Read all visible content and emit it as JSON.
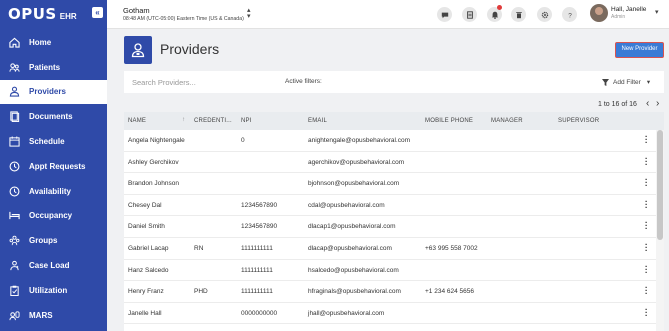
{
  "app": {
    "logo_main": "OPUS",
    "logo_sub": "EHR"
  },
  "location": {
    "name": "Gotham",
    "time": "08:48 AM (UTC-05:00) Eastern Time (US & Canada)"
  },
  "user": {
    "name": "Hall, Janelle",
    "role": "Admin"
  },
  "sidebar": {
    "items": [
      {
        "label": "Home",
        "icon": "home-icon"
      },
      {
        "label": "Patients",
        "icon": "patients-icon"
      },
      {
        "label": "Providers",
        "icon": "providers-icon",
        "active": true
      },
      {
        "label": "Documents",
        "icon": "documents-icon"
      },
      {
        "label": "Schedule",
        "icon": "calendar-icon"
      },
      {
        "label": "Appt Requests",
        "icon": "clock-icon"
      },
      {
        "label": "Availability",
        "icon": "clock-icon"
      },
      {
        "label": "Occupancy",
        "icon": "bed-icon"
      },
      {
        "label": "Groups",
        "icon": "groups-icon"
      },
      {
        "label": "Case Load",
        "icon": "caseload-icon"
      },
      {
        "label": "Utilization",
        "icon": "clipboard-icon"
      },
      {
        "label": "MARS",
        "icon": "mars-icon"
      }
    ]
  },
  "page": {
    "title": "Providers",
    "new_button": "New Provider"
  },
  "search": {
    "placeholder": "Search Providers..."
  },
  "filters": {
    "active_label": "Active filters:",
    "add_label": "Add Filter"
  },
  "pagination": {
    "text": "1 to 16 of 16"
  },
  "table": {
    "columns": [
      "NAME",
      "CREDENTI...",
      "NPI",
      "EMAIL",
      "MOBILE PHONE",
      "MANAGER",
      "SUPERVISOR"
    ],
    "rows": [
      [
        "Angela Nightengale",
        "",
        "0",
        "anightengale@opusbehavioral.com",
        "",
        "",
        ""
      ],
      [
        "Ashley Gerchikov",
        "",
        "",
        "agerchikov@opusbehavioral.com",
        "",
        "",
        ""
      ],
      [
        "Brandon Johnson",
        "",
        "",
        "bjohnson@opusbehavioral.com",
        "",
        "",
        ""
      ],
      [
        "Chesey Dal",
        "",
        "1234567890",
        "cdal@opusbehavioral.com",
        "",
        "",
        ""
      ],
      [
        "Daniel Smith",
        "",
        "1234567890",
        "dlacap1@opusbehavioral.com",
        "",
        "",
        ""
      ],
      [
        "Gabriel Lacap",
        "RN",
        "1111111111",
        "dlacap@opusbehavioral.com",
        "+63 995 558 7002",
        "",
        ""
      ],
      [
        "Hanz Salcedo",
        "",
        "1111111111",
        "hsalcedo@opusbehavioral.com",
        "",
        "",
        ""
      ],
      [
        "Henry Franz",
        "PHD",
        "1111111111",
        "hfraginals@opusbehavioral.com",
        "+1 234 624 5656",
        "",
        ""
      ],
      [
        "Janelle Hall",
        "",
        "0000000000",
        "jhall@opusbehavioral.com",
        "",
        "",
        ""
      ]
    ]
  }
}
